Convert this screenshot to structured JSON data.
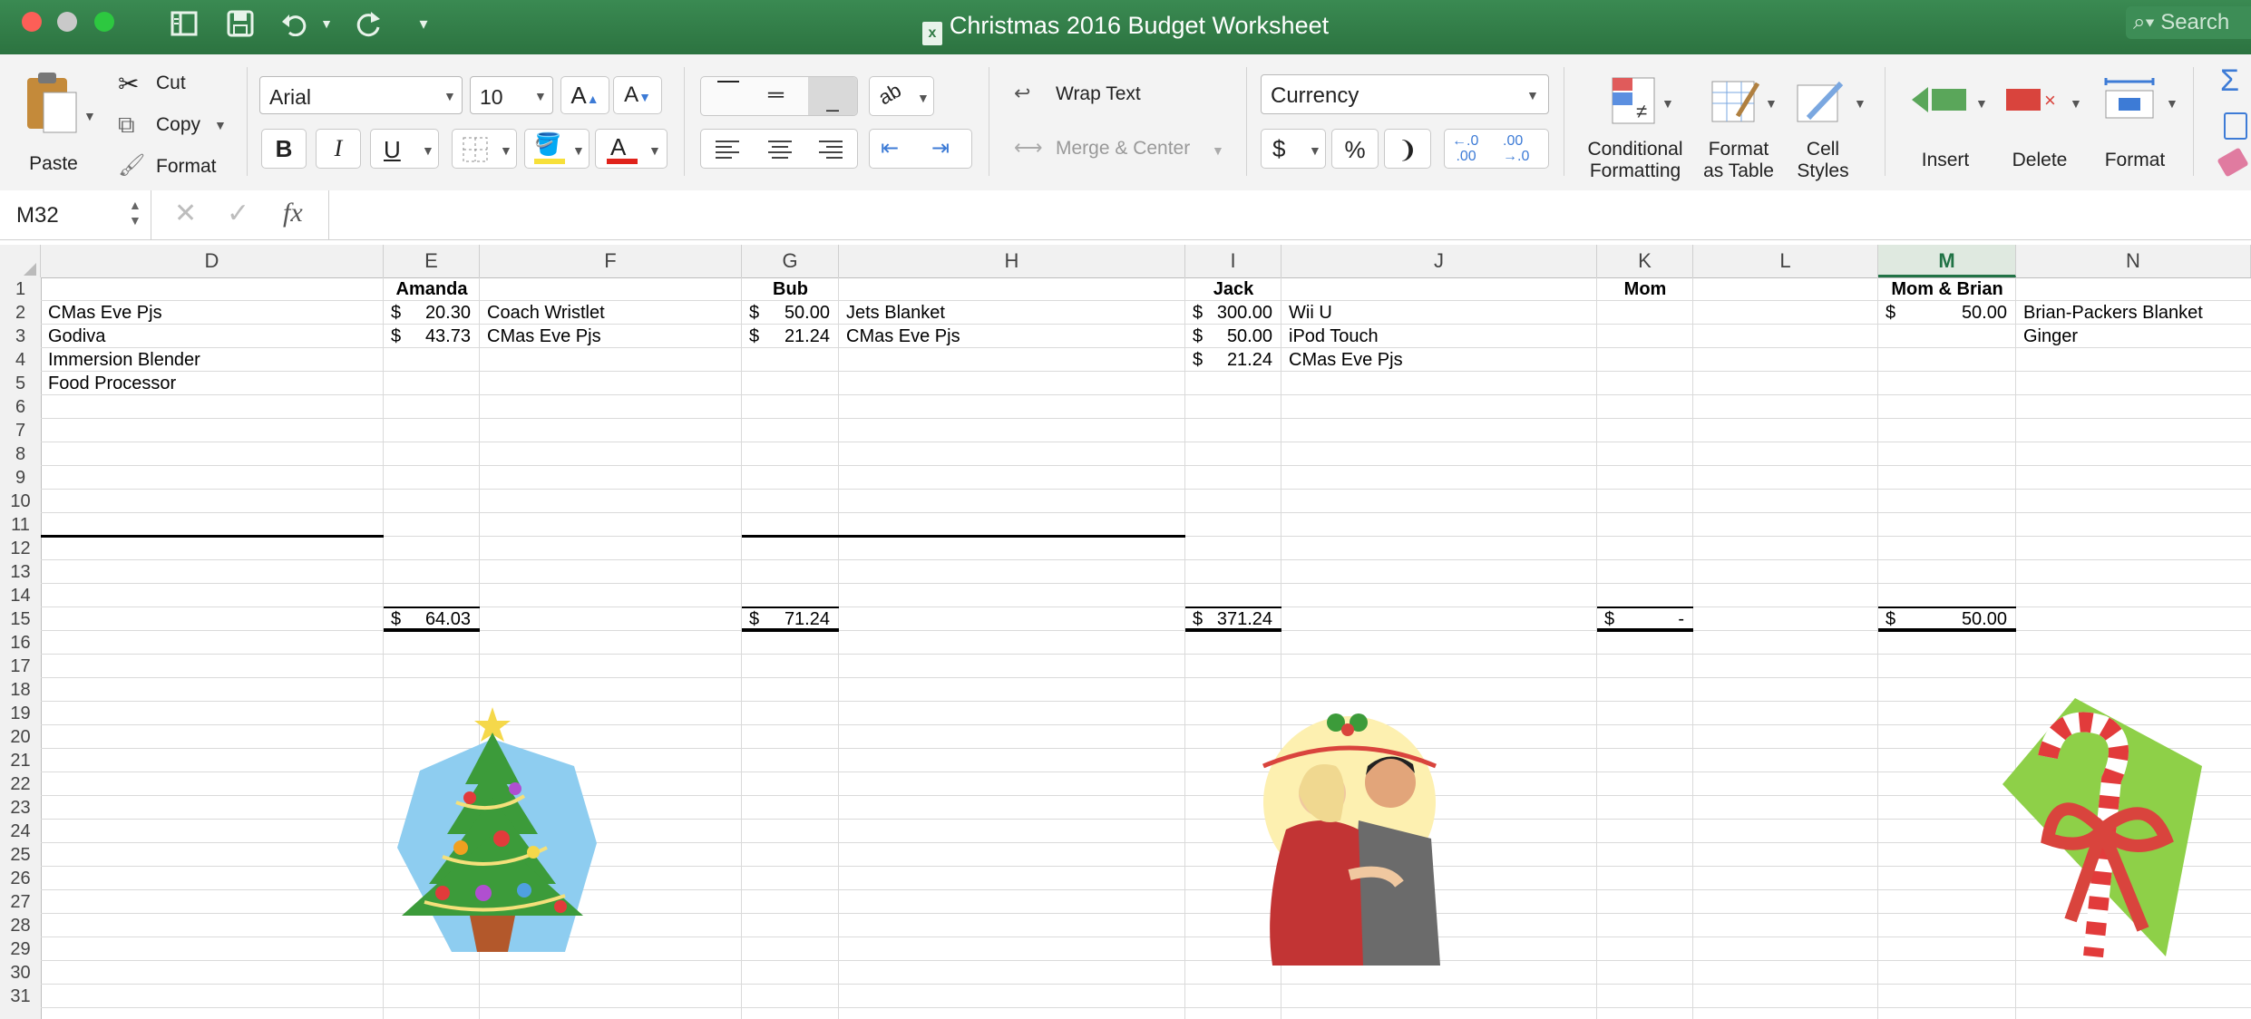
{
  "window": {
    "title": "Christmas 2016 Budget Worksheet",
    "search_placeholder": "Search"
  },
  "ribbon": {
    "clipboard": {
      "paste": "Paste",
      "cut": "Cut",
      "copy": "Copy",
      "format": "Format"
    },
    "font": {
      "name": "Arial",
      "size": "10"
    },
    "alignment": {
      "wrap_text": "Wrap Text",
      "merge_center": "Merge & Center"
    },
    "number": {
      "format": "Currency"
    },
    "styles": {
      "conditional_formatting": [
        "Conditional",
        "Formatting"
      ],
      "format_as_table": [
        "Format",
        "as Table"
      ],
      "cell_styles": [
        "Cell",
        "Styles"
      ]
    },
    "cells": {
      "insert": "Insert",
      "delete": "Delete",
      "format": "Format"
    }
  },
  "formula_bar": {
    "name_box": "M32",
    "fx": "fx",
    "value": ""
  },
  "sheet": {
    "columns": [
      "D",
      "E",
      "F",
      "G",
      "H",
      "I",
      "J",
      "K",
      "L",
      "M",
      "N"
    ],
    "selected_column": "M",
    "rows": [
      "1",
      "2",
      "3",
      "4",
      "5",
      "6",
      "7",
      "8",
      "9",
      "10",
      "11",
      "12",
      "13",
      "14",
      "15",
      "16",
      "17",
      "18",
      "19",
      "20",
      "21",
      "22",
      "23",
      "24",
      "25",
      "26",
      "27",
      "28",
      "29",
      "30",
      "31"
    ],
    "headers": {
      "amanda": "Amanda",
      "bub": "Bub",
      "jack": "Jack",
      "mom": "Mom",
      "mom_brian": "Mom & Brian"
    },
    "d_items": [
      "CMas Eve Pjs",
      "Godiva",
      "Immersion Blender",
      "Food Processor"
    ],
    "amanda": {
      "amounts": [
        "20.30",
        "43.73"
      ],
      "items": [
        "Coach Wristlet",
        "CMas Eve Pjs"
      ],
      "total": "64.03"
    },
    "bub": {
      "amounts": [
        "50.00",
        "21.24"
      ],
      "items": [
        "Jets Blanket",
        "CMas Eve Pjs"
      ],
      "total": "71.24"
    },
    "jack": {
      "amounts": [
        "300.00",
        "50.00",
        "21.24"
      ],
      "items": [
        "Wii U",
        "iPod Touch",
        "CMas Eve Pjs"
      ],
      "total": "371.24"
    },
    "mom": {
      "total": "-"
    },
    "mom_brian": {
      "amounts": [
        "50.00"
      ],
      "total": "50.00"
    },
    "n_items": [
      "Brian-Packers Blanket",
      "Ginger"
    ],
    "currency_symbol": "$"
  },
  "images": [
    "christmas-tree-clipart",
    "couple-mistletoe-clipart",
    "candy-cane-gift-clipart"
  ],
  "colors": {
    "excel_green": "#217346",
    "titlebar_green": "#2f7a44"
  }
}
